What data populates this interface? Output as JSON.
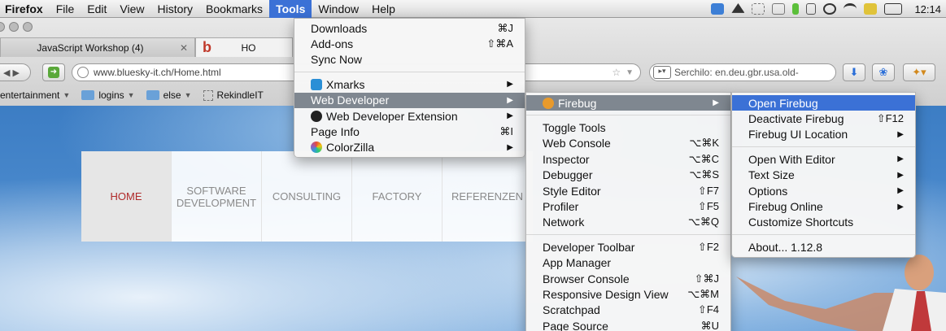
{
  "menubar": {
    "app": "Firefox",
    "items": [
      "File",
      "Edit",
      "View",
      "History",
      "Bookmarks",
      "Tools",
      "Window",
      "Help"
    ],
    "open_index": 5,
    "clock": "12:14"
  },
  "tabs": [
    {
      "title": "JavaScript Workshop (4)"
    },
    {
      "logo": "b",
      "title": "HO"
    }
  ],
  "navbar": {
    "url": "www.bluesky-it.ch/Home.html",
    "search": "Serchilo: en.deu.gbr.usa.old-"
  },
  "bookmarks": [
    {
      "label": "entertainment",
      "type": "folder"
    },
    {
      "label": "logins",
      "type": "folder"
    },
    {
      "label": "else",
      "type": "folder"
    },
    {
      "label": "RekindleIT",
      "type": "page"
    }
  ],
  "site_nav": {
    "items": [
      "HOME",
      "SOFTWARE DEVELOPMENT",
      "CONSULTING",
      "FACTORY",
      "REFERENZEN"
    ],
    "active_index": 0
  },
  "tools_menu": {
    "group1": [
      {
        "label": "Downloads",
        "shortcut": "⌘J"
      },
      {
        "label": "Add-ons",
        "shortcut": "⇧⌘A"
      },
      {
        "label": "Sync Now",
        "shortcut": ""
      }
    ],
    "group2": [
      {
        "label": "Xmarks",
        "icon": "xmarks-icon",
        "submenu": true
      },
      {
        "label": "Web Developer",
        "submenu": true,
        "highlighted": true
      },
      {
        "label": "Web Developer Extension",
        "icon": "gear-icon",
        "submenu": true
      },
      {
        "label": "Page Info",
        "shortcut": "⌘I"
      },
      {
        "label": "ColorZilla",
        "icon": "colorzilla-icon",
        "submenu": true
      }
    ]
  },
  "webdev_menu": {
    "group1": [
      {
        "label": "Firebug",
        "icon": "firebug-icon",
        "submenu": true,
        "highlighted": true
      }
    ],
    "group2": [
      {
        "label": "Toggle Tools",
        "shortcut": ""
      },
      {
        "label": "Web Console",
        "shortcut": "⌥⌘K"
      },
      {
        "label": "Inspector",
        "shortcut": "⌥⌘C"
      },
      {
        "label": "Debugger",
        "shortcut": "⌥⌘S"
      },
      {
        "label": "Style Editor",
        "shortcut": "⇧F7"
      },
      {
        "label": "Profiler",
        "shortcut": "⇧F5"
      },
      {
        "label": "Network",
        "shortcut": "⌥⌘Q"
      }
    ],
    "group3": [
      {
        "label": "Developer Toolbar",
        "shortcut": "⇧F2"
      },
      {
        "label": "App Manager",
        "shortcut": ""
      },
      {
        "label": "Browser Console",
        "shortcut": "⇧⌘J"
      },
      {
        "label": "Responsive Design View",
        "shortcut": "⌥⌘M"
      },
      {
        "label": "Scratchpad",
        "shortcut": "⇧F4"
      },
      {
        "label": "Page Source",
        "shortcut": "⌘U"
      }
    ]
  },
  "firebug_menu": {
    "group1": [
      {
        "label": "Open Firebug",
        "shortcut": "",
        "highlighted": true
      },
      {
        "label": "Deactivate Firebug",
        "shortcut": "⇧F12"
      },
      {
        "label": "Firebug UI Location",
        "submenu": true
      }
    ],
    "group2": [
      {
        "label": "Open With Editor",
        "submenu": true
      },
      {
        "label": "Text Size",
        "submenu": true
      },
      {
        "label": "Options",
        "submenu": true
      },
      {
        "label": "Firebug Online",
        "submenu": true
      },
      {
        "label": "Customize Shortcuts",
        "shortcut": ""
      }
    ],
    "group3": [
      {
        "label": "About... 1.12.8",
        "shortcut": ""
      }
    ]
  },
  "colors": {
    "menu_highlight": "#3b71d6",
    "active_nav_text": "#b02a2a",
    "sky": "#3f83c9"
  }
}
